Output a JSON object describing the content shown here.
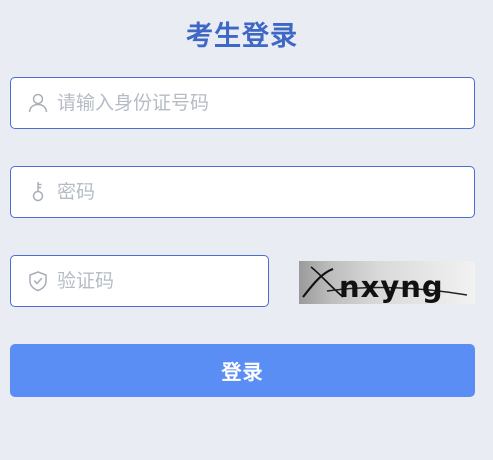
{
  "title": "考生登录",
  "form": {
    "id_field": {
      "icon": "user-icon",
      "placeholder": "请输入身份证号码",
      "value": ""
    },
    "password_field": {
      "icon": "key-icon",
      "placeholder": "密码",
      "value": ""
    },
    "captcha_field": {
      "icon": "shield-icon",
      "placeholder": "验证码",
      "value": ""
    },
    "captcha_image": {
      "text": "nxyng"
    }
  },
  "login_button": {
    "label": "登录"
  },
  "colors": {
    "background": "#e9ecf2",
    "title": "#3f67c6",
    "field_border": "#4a6ed3",
    "button": "#5b8ef4",
    "placeholder": "#b6bcc6"
  }
}
